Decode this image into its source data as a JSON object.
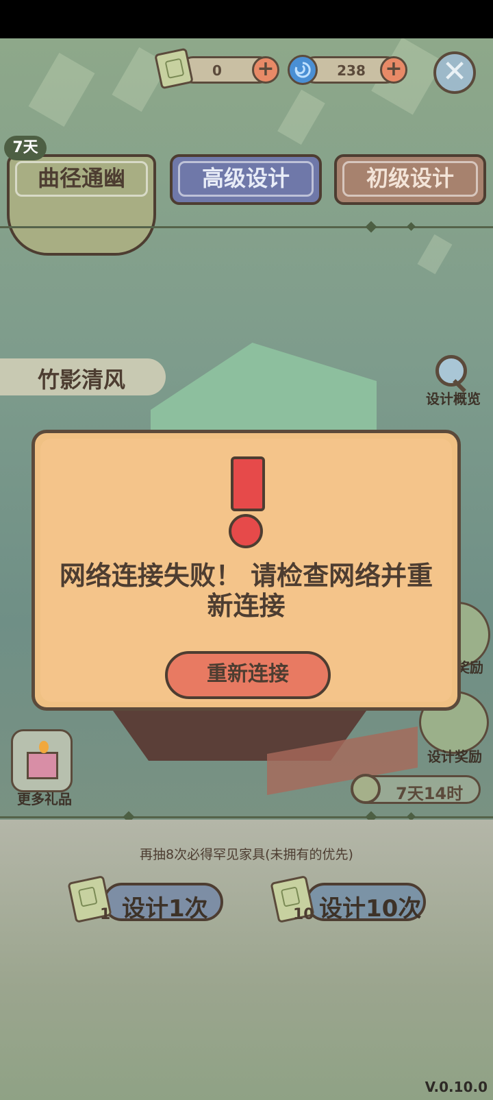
{
  "currency": {
    "tickets_value": "0",
    "gems_value": "238",
    "plus_glyph": "+",
    "close_glyph": "✕"
  },
  "tabs": {
    "badge": "7天",
    "tab1": "曲径通幽",
    "tab2": "高级设计",
    "tab3": "初级设计"
  },
  "scene": {
    "set_name": "竹影清风",
    "overview_label": "设计概览",
    "reward_label_partial": "奖励",
    "design_reward_label": "设计奖励",
    "more_gifts_label": "更多礼品",
    "timer": "7天14时"
  },
  "dialog": {
    "message": "网络连接失败！ 请检查网络并重新连接",
    "retry_label": "重新连接"
  },
  "bottom": {
    "pity_text": "再抽8次必得罕见家具(未拥有的优先)",
    "design1_label": "设计1次",
    "design1_cost": "1",
    "design10_label": "设计10次",
    "design10_cost": "10",
    "version": "V.0.10.0"
  },
  "colors": {
    "dialog_bg": "#f4c48a",
    "retry_button": "#e87a62",
    "tab_active": "#a8ae83",
    "tab_advanced": "#6f78a9",
    "tab_basic": "#a7826e"
  }
}
